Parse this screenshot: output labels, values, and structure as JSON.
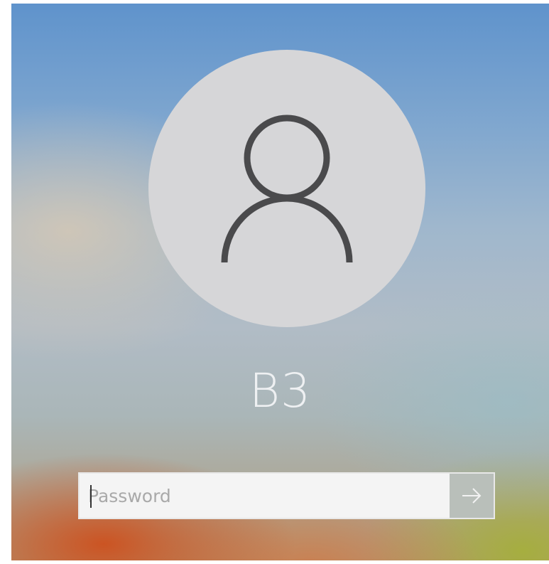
{
  "user": {
    "name": "B3",
    "avatar_icon": "user-icon"
  },
  "password": {
    "placeholder": "Password",
    "value": ""
  },
  "submit": {
    "icon": "arrow-right-icon"
  },
  "colors": {
    "avatar_background": "#d6d6d8",
    "icon_stroke": "#4a4a4c",
    "username_text": "#eef0f2",
    "input_background": "#f4f4f4",
    "submit_background": "#b9bfba"
  }
}
